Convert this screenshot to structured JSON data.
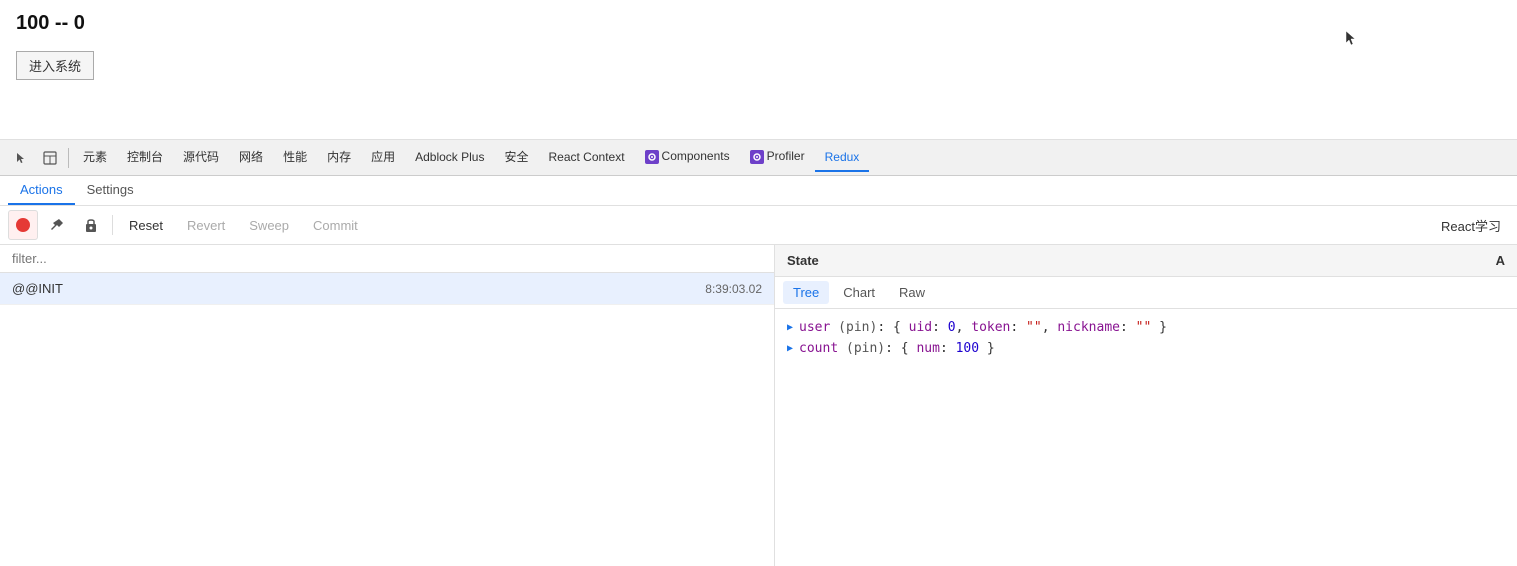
{
  "top": {
    "title": "100 -- 0",
    "button_label": "进入系统"
  },
  "devtools": {
    "icon_cursor": "↖",
    "icon_panel": "⊡",
    "nav_items": [
      {
        "label": "元素",
        "active": false
      },
      {
        "label": "控制台",
        "active": false
      },
      {
        "label": "源代码",
        "active": false
      },
      {
        "label": "网络",
        "active": false
      },
      {
        "label": "性能",
        "active": false
      },
      {
        "label": "内存",
        "active": false
      },
      {
        "label": "应用",
        "active": false
      },
      {
        "label": "Adblock Plus",
        "active": false
      },
      {
        "label": "安全",
        "active": false
      },
      {
        "label": "React Context",
        "active": false
      },
      {
        "label": "Components",
        "active": false
      },
      {
        "label": "Profiler",
        "active": false
      },
      {
        "label": "Redux",
        "active": true
      }
    ]
  },
  "redux": {
    "tabs": [
      {
        "label": "Actions",
        "active": true
      },
      {
        "label": "Settings",
        "active": false
      }
    ],
    "toolbar": {
      "record_label": "record",
      "pin_label": "pin",
      "lock_label": "lock",
      "reset_label": "Reset",
      "revert_label": "Revert",
      "sweep_label": "Sweep",
      "commit_label": "Commit",
      "instance_label": "React学习"
    },
    "filter_placeholder": "filter...",
    "actions": [
      {
        "name": "@@INIT",
        "time": "8:39:03.02"
      }
    ],
    "state_panel": {
      "header": "State",
      "header_right": "A",
      "tabs": [
        {
          "label": "Tree",
          "active": true
        },
        {
          "label": "Chart",
          "active": false
        },
        {
          "label": "Raw",
          "active": false
        }
      ],
      "tree_items": [
        {
          "key": "user",
          "pin": " (pin)",
          "value": "{ uid: 0, token: \"\", nickname: \"\" }"
        },
        {
          "key": "count",
          "pin": " (pin)",
          "value": "{ num: 100 }"
        }
      ]
    }
  }
}
